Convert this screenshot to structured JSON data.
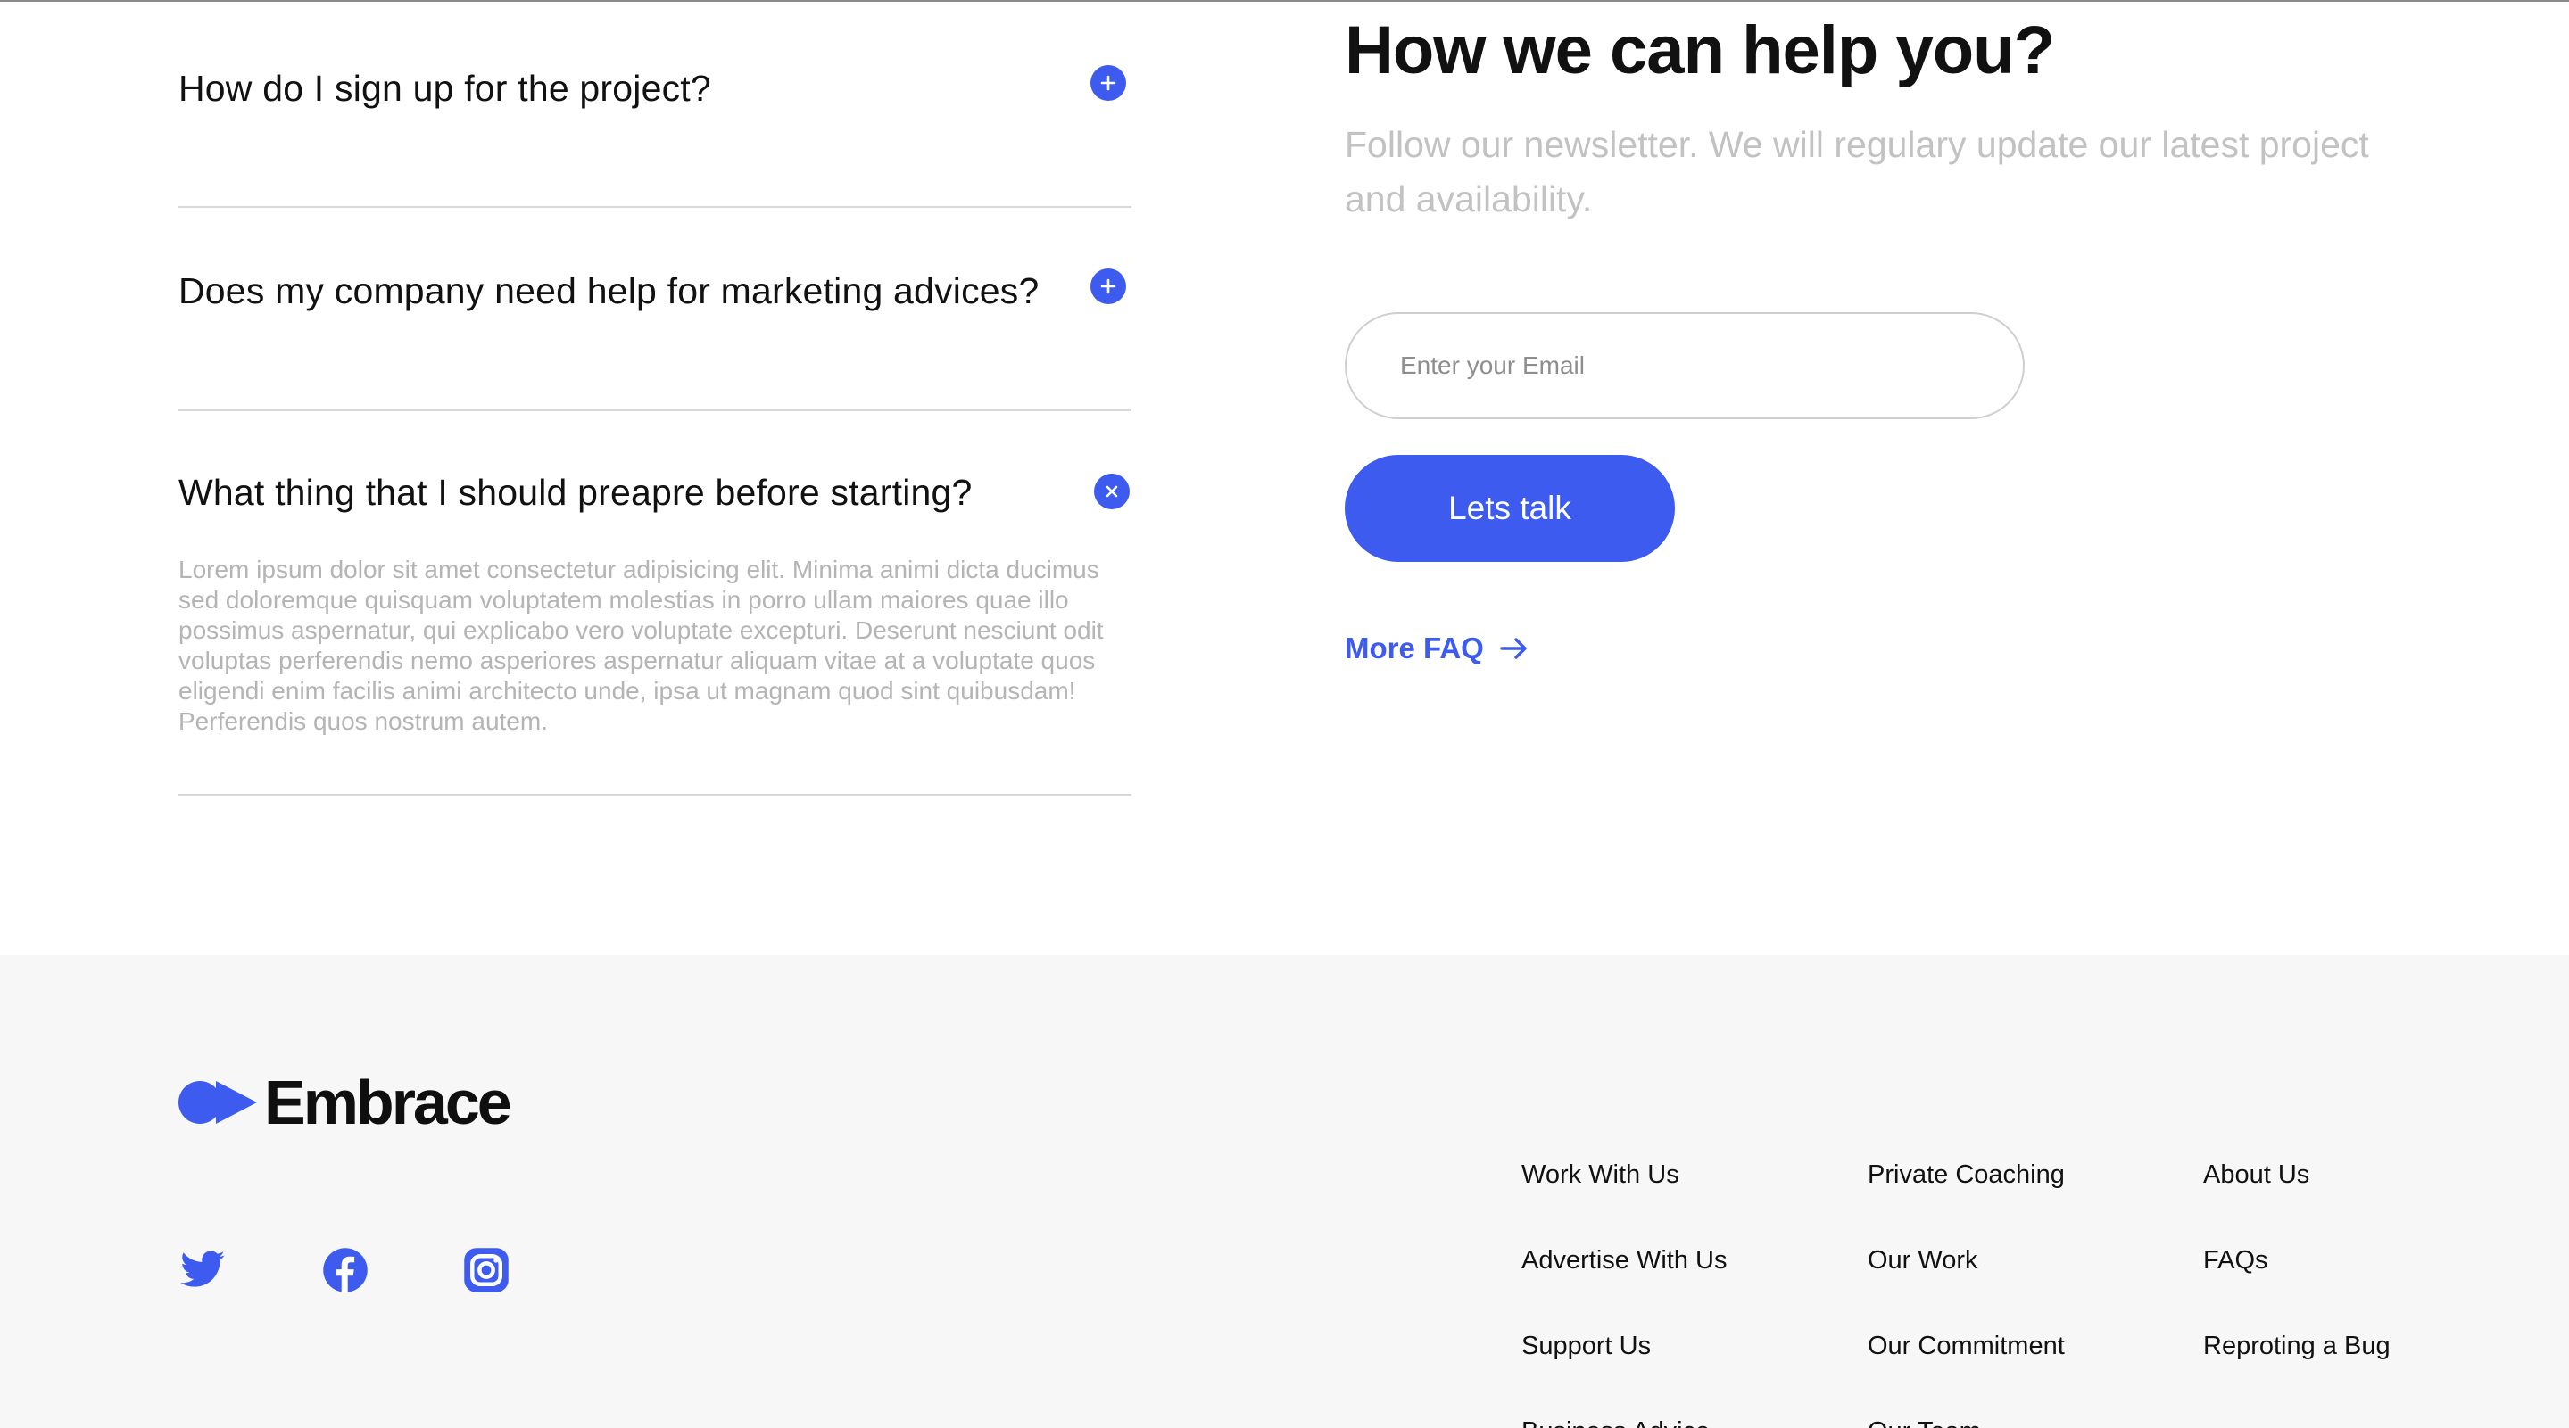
{
  "faq": {
    "items": [
      {
        "question": "How do I sign up for the project?",
        "state": "collapsed"
      },
      {
        "question": "Does my company need help for marketing advices?",
        "state": "collapsed"
      },
      {
        "question": "What thing that I should preapre before starting?",
        "state": "expanded",
        "answer": "Lorem ipsum dolor sit amet consectetur adipisicing elit. Minima animi dicta ducimus sed doloremque quisquam voluptatem molestias in porro ullam maiores quae illo possimus aspernatur, qui explicabo vero voluptate excepturi. Deserunt nesciunt odit voluptas perferendis nemo asperiores aspernatur aliquam vitae at a voluptate quos eligendi enim facilis animi architecto unde, ipsa ut magnam quod sint quibusdam! Perferendis quos nostrum autem."
      }
    ],
    "icons": {
      "collapsed": "plus-circle-icon",
      "expanded": "close-circle-icon"
    }
  },
  "help": {
    "title": "How we can help you?",
    "subtitle": "Follow our newsletter. We will regulary update our latest project and availability.",
    "email_placeholder": "Enter your Email",
    "email_value": "",
    "cta_label": "Lets talk",
    "more_faq_label": "More FAQ",
    "more_faq_icon": "arrow-right-icon"
  },
  "footer": {
    "logo_text": "Embrace",
    "logo_icon": "embrace-logo-mark",
    "social": [
      {
        "name": "twitter",
        "icon": "twitter-icon"
      },
      {
        "name": "facebook",
        "icon": "facebook-icon"
      },
      {
        "name": "instagram",
        "icon": "instagram-icon"
      }
    ],
    "columns": [
      [
        "Work With Us",
        "Advertise With Us",
        "Support Us",
        "Business Advice"
      ],
      [
        "Private Coaching",
        "Our Work",
        "Our Commitment",
        "Our Team"
      ],
      [
        "About Us",
        "FAQs",
        "Reproting a Bug"
      ]
    ]
  },
  "colors": {
    "accent": "#3e5bf0",
    "text": "#111111",
    "muted_text": "#b4b4b4",
    "divider": "#d9d9d9",
    "footer_bg": "#f8f7f7"
  }
}
